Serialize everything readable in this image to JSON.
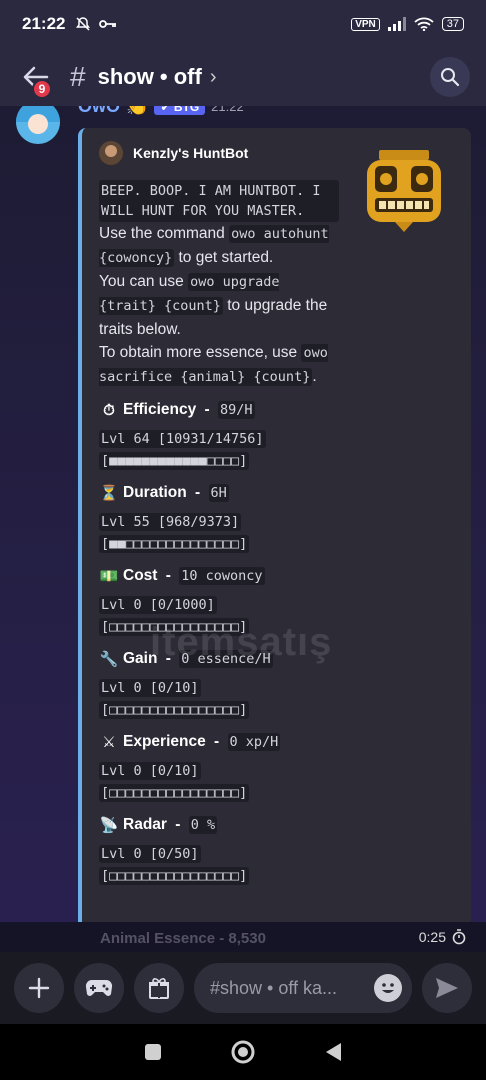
{
  "status_bar": {
    "time": "21:22",
    "vpn": "VPN",
    "battery": "37"
  },
  "header": {
    "back_badge": "9",
    "channel": "show • off",
    "chevron": "›"
  },
  "message": {
    "username": "OwO",
    "bot_tag": "✔ BTG",
    "time": "21:22"
  },
  "embed": {
    "author": "Kenzly's HuntBot",
    "intro_mono": "BEEP. BOOP. I AM HUNTBOT. I WILL HUNT FOR YOU MASTER.",
    "line1_a": "Use the command ",
    "line1_code": "owo autohunt {cowoncy}",
    "line1_b": " to get started.",
    "line2_a": "You can use ",
    "line2_code": "owo upgrade {trait} {count}",
    "line2_b": " to upgrade the traits below.",
    "line3_a": "To obtain more essence, use ",
    "line3_code": "owo sacrifice {animal} {count}",
    "line3_b": ".",
    "traits": [
      {
        "icon": "⏱",
        "name": "Efficiency",
        "value": "89/H",
        "level": "Lvl 64 [10931/14756]",
        "bar": "[■■■■■■■■■■■■□□□□]"
      },
      {
        "icon": "⏳",
        "name": "Duration",
        "value": "6H",
        "level": "Lvl 55 [968/9373]",
        "bar": "[■■□□□□□□□□□□□□□□]"
      },
      {
        "icon": "💵",
        "name": "Cost",
        "value": "10 cowoncy",
        "level": "Lvl 0 [0/1000]",
        "bar": "[□□□□□□□□□□□□□□□□]"
      },
      {
        "icon": "🔧",
        "name": "Gain",
        "value": "0 essence/H",
        "level": "Lvl 0 [0/10]",
        "bar": "[□□□□□□□□□□□□□□□□]"
      },
      {
        "icon": "⚔",
        "name": "Experience",
        "value": "0 xp/H",
        "level": "Lvl 0 [0/10]",
        "bar": "[□□□□□□□□□□□□□□□□]"
      },
      {
        "icon": "📡",
        "name": "Radar",
        "value": "0 %",
        "level": "Lvl 0 [0/50]",
        "bar": "[□□□□□□□□□□□□□□□□]"
      }
    ],
    "peek": "Animal Essence - 8,530"
  },
  "timer": "0:25",
  "input": {
    "placeholder": "#show • off ka..."
  },
  "watermark": "itemsatış",
  "colors": {
    "accent_bar": "#6ab0e8",
    "badge": "#e2384a",
    "bot_tag": "#5865f2"
  }
}
